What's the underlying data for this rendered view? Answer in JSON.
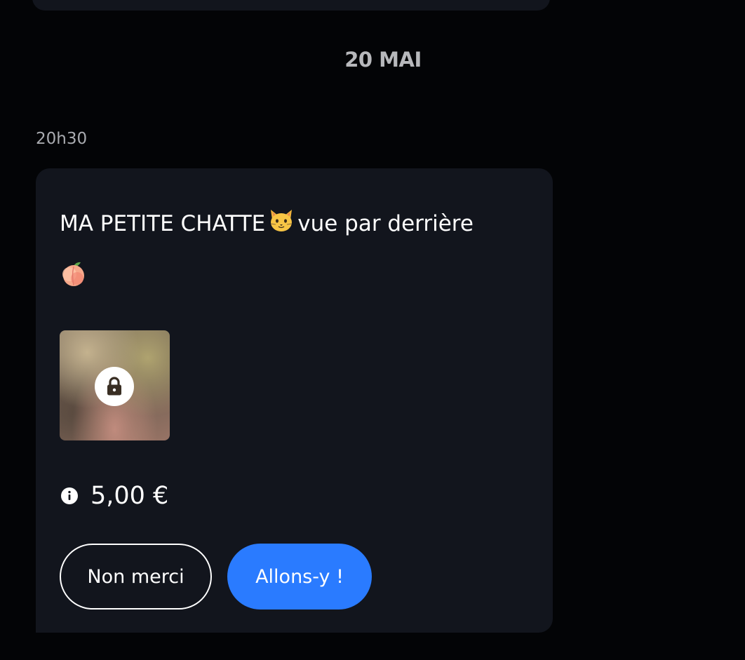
{
  "thread": {
    "date_separator": "20 MAI",
    "message": {
      "time": "20h30",
      "text_before_emoji": "MA PETITE CHATTE",
      "text_after_emoji": "vue par derrière",
      "emojis": [
        "cat-face-emoji",
        "peach-emoji"
      ],
      "media": {
        "locked": true,
        "icon": "lock-icon"
      },
      "price_info_icon": "info-icon",
      "price": "5,00 €",
      "decline_label": "Non merci",
      "accept_label": "Allons-y !"
    }
  },
  "colors": {
    "background": "#030406",
    "bubble": "#12151d",
    "accent": "#2a7bff",
    "muted_text": "#a9abb0"
  }
}
